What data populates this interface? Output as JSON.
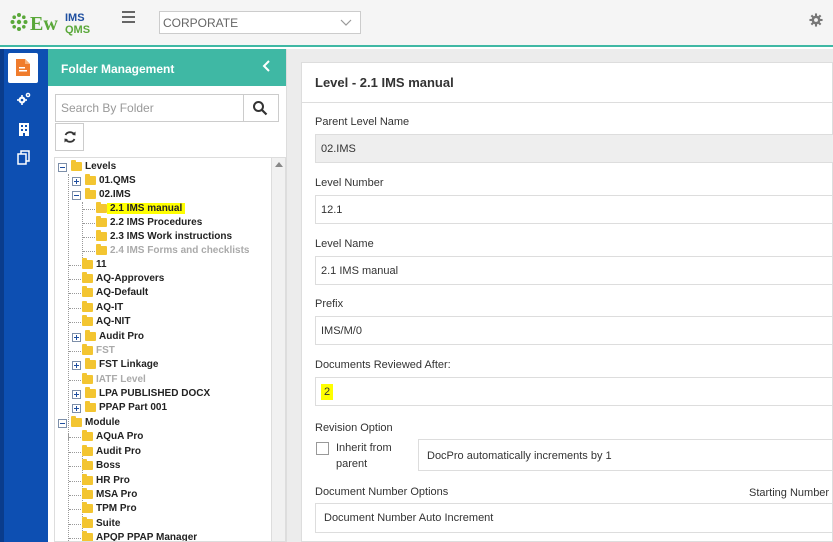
{
  "header": {
    "logo_text": "EwQIMS",
    "organization": "CORPORATE",
    "icons": [
      "menu-icon",
      "chevron-down-icon",
      "gear-icon"
    ]
  },
  "rail": {
    "icons": [
      "document-icon",
      "settings-icon",
      "building-icon",
      "copy-icon"
    ]
  },
  "folder_panel": {
    "title": "Folder Management",
    "search_placeholder": "Search By Folder",
    "tree": [
      {
        "label": "Levels"
      },
      {
        "label": "01.QMS"
      },
      {
        "label": "02.IMS"
      },
      {
        "label": "2.1 IMS manual",
        "selected": true
      },
      {
        "label": "2.2 IMS Procedures"
      },
      {
        "label": "2.3 IMS Work instructions"
      },
      {
        "label": "2.4 IMS Forms and checklists",
        "disabled": true
      },
      {
        "label": "11"
      },
      {
        "label": "AQ-Approvers"
      },
      {
        "label": "AQ-Default"
      },
      {
        "label": "AQ-IT"
      },
      {
        "label": "AQ-NIT"
      },
      {
        "label": "Audit Pro"
      },
      {
        "label": "FST",
        "disabled": true
      },
      {
        "label": "FST Linkage"
      },
      {
        "label": "IATF Level",
        "disabled": true
      },
      {
        "label": "LPA PUBLISHED DOCX"
      },
      {
        "label": "PPAP Part 001"
      },
      {
        "label": "Module"
      },
      {
        "label": "AQuA Pro"
      },
      {
        "label": "Audit Pro"
      },
      {
        "label": "Boss"
      },
      {
        "label": "HR Pro"
      },
      {
        "label": "MSA Pro"
      },
      {
        "label": "TPM Pro"
      },
      {
        "label": "Suite"
      },
      {
        "label": "APQP PPAP Manager"
      }
    ]
  },
  "form": {
    "title": "Level - 2.1 IMS manual",
    "parent_level_label": "Parent Level Name",
    "parent_level_value": "02.IMS",
    "level_number_label": "Level Number",
    "level_number_value": "12.1",
    "level_name_label": "Level Name",
    "level_name_value": "2.1 IMS manual",
    "prefix_label": "Prefix",
    "prefix_value": "IMS/M/0",
    "reviewed_after_label": "Documents Reviewed After:",
    "reviewed_after_value": "2",
    "revision_label": "Revision Option",
    "inherit_label": "Inherit from parent",
    "revision_value": "DocPro automatically increments by 1",
    "doc_number_label": "Document Number Options",
    "starting_number_label": "Starting Number",
    "doc_number_value": "Document Number Auto Increment"
  }
}
